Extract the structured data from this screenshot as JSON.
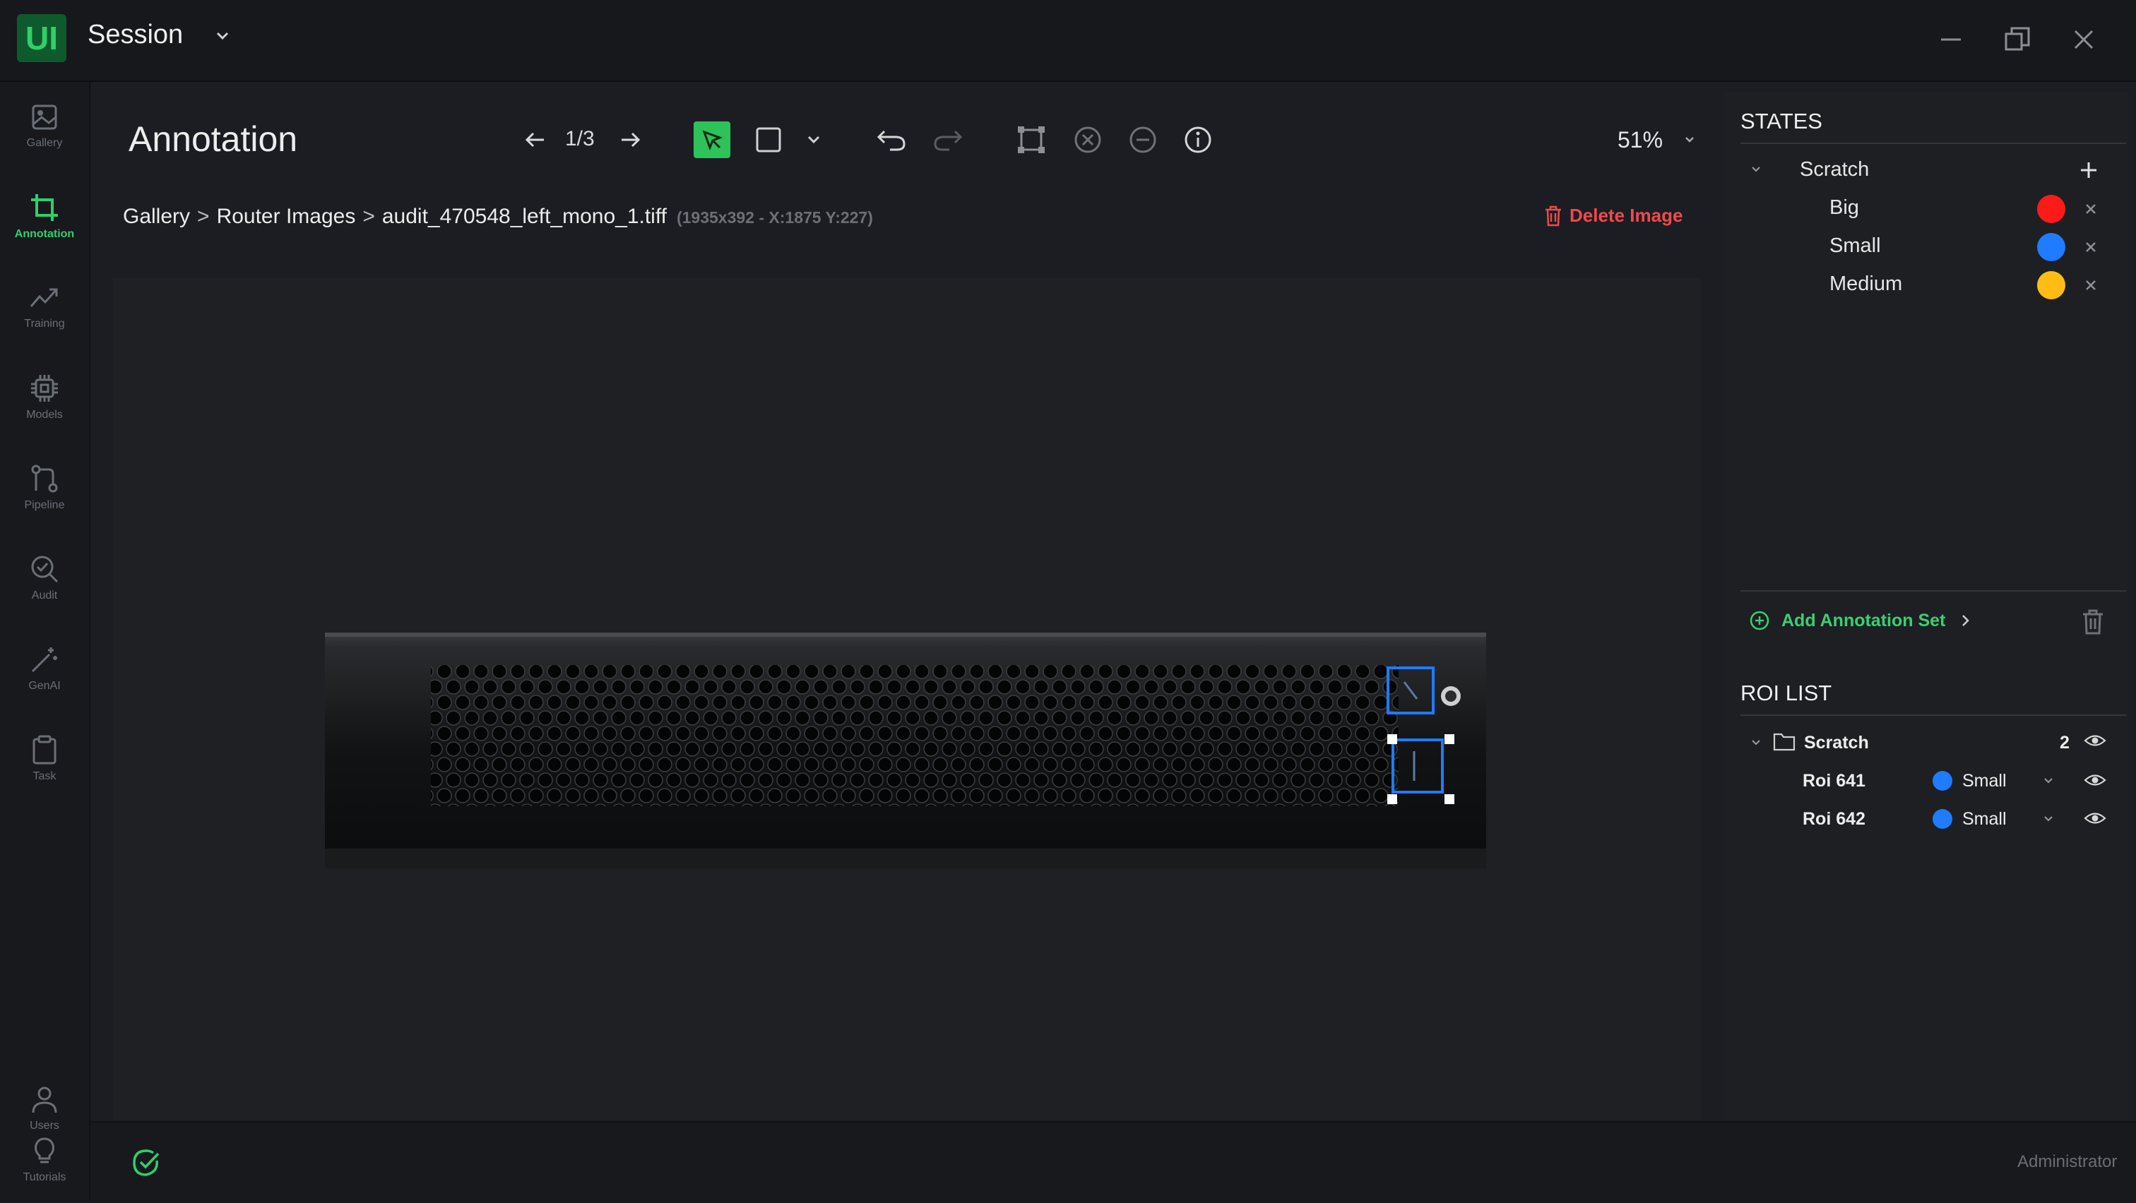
{
  "app": {
    "title": "Session",
    "logo_text": "UI"
  },
  "nav": {
    "items": [
      {
        "label": "Gallery",
        "icon": "image-icon"
      },
      {
        "label": "Annotation",
        "icon": "crop-icon",
        "active": true
      },
      {
        "label": "Training",
        "icon": "trend-icon"
      },
      {
        "label": "Models",
        "icon": "chip-icon"
      },
      {
        "label": "Pipeline",
        "icon": "pipeline-icon"
      },
      {
        "label": "Audit",
        "icon": "search-check-icon"
      },
      {
        "label": "GenAI",
        "icon": "magic-wand-icon"
      },
      {
        "label": "Task",
        "icon": "clipboard-icon"
      },
      {
        "label": "Users",
        "icon": "user-icon"
      },
      {
        "label": "Tutorials",
        "icon": "lightbulb-icon"
      }
    ]
  },
  "toolbar": {
    "title": "Annotation",
    "pager": "1/3",
    "zoom": "51%"
  },
  "breadcrumb": {
    "items": [
      "Gallery",
      "Router Images",
      "audit_470548_left_mono_1.tiff"
    ],
    "separator": ">",
    "meta": "(1935x392 - X:1875 Y:227)"
  },
  "delete_image_label": "Delete Image",
  "states": {
    "title": "STATES",
    "group": "Scratch",
    "items": [
      {
        "label": "Big",
        "color": "#ff1a1a"
      },
      {
        "label": "Small",
        "color": "#1f7bff"
      },
      {
        "label": "Medium",
        "color": "#ffbd14"
      }
    ],
    "add_set_label": "Add Annotation Set"
  },
  "roi": {
    "title": "ROI LIST",
    "group": "Scratch",
    "count": "2",
    "items": [
      {
        "name": "Roi 641",
        "state": "Small",
        "color": "#1f7bff"
      },
      {
        "name": "Roi 642",
        "state": "Small",
        "color": "#1f7bff"
      }
    ]
  },
  "footer": {
    "user": "Administrator"
  }
}
